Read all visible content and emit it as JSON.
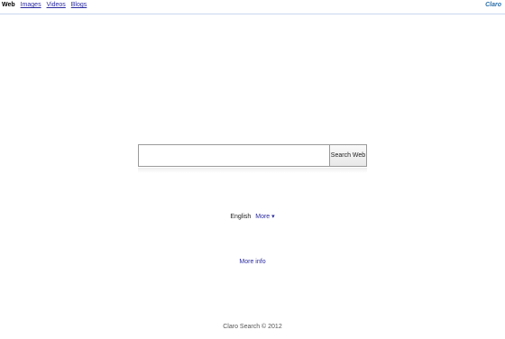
{
  "nav": {
    "items": [
      {
        "label": "Web",
        "active": true
      },
      {
        "label": "Images",
        "active": false
      },
      {
        "label": "Videos",
        "active": false
      },
      {
        "label": "Blogs",
        "active": false
      }
    ]
  },
  "brand": "Claro",
  "search": {
    "value": "",
    "placeholder": "",
    "button_label": "Search Web"
  },
  "language": {
    "current": "English",
    "more_label": "More",
    "more_icon": "triangle-down-icon"
  },
  "info_link": "More info",
  "footer": "Claro Search © 2012",
  "colors": {
    "link": "#2a2aa0",
    "brand": "#2b6ea8",
    "topbar_border": "#c9d7f1"
  }
}
